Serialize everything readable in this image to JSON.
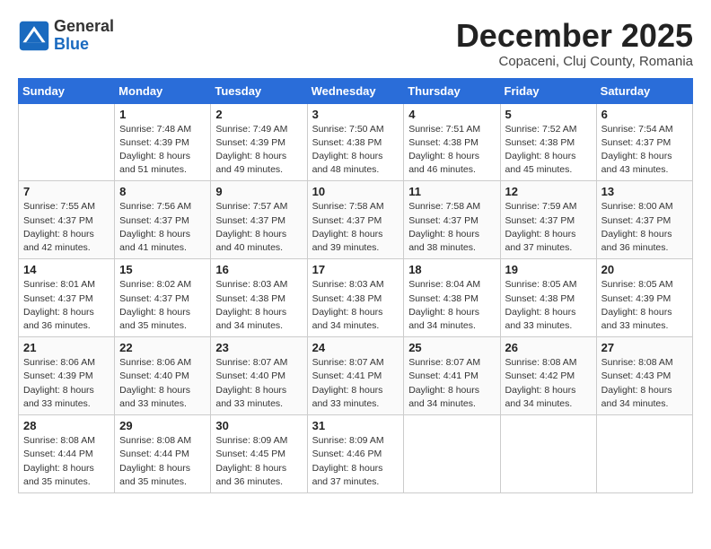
{
  "header": {
    "logo_line1": "General",
    "logo_line2": "Blue",
    "month": "December 2025",
    "location": "Copaceni, Cluj County, Romania"
  },
  "weekdays": [
    "Sunday",
    "Monday",
    "Tuesday",
    "Wednesday",
    "Thursday",
    "Friday",
    "Saturday"
  ],
  "weeks": [
    [
      {
        "day": "",
        "info": ""
      },
      {
        "day": "1",
        "info": "Sunrise: 7:48 AM\nSunset: 4:39 PM\nDaylight: 8 hours\nand 51 minutes."
      },
      {
        "day": "2",
        "info": "Sunrise: 7:49 AM\nSunset: 4:39 PM\nDaylight: 8 hours\nand 49 minutes."
      },
      {
        "day": "3",
        "info": "Sunrise: 7:50 AM\nSunset: 4:38 PM\nDaylight: 8 hours\nand 48 minutes."
      },
      {
        "day": "4",
        "info": "Sunrise: 7:51 AM\nSunset: 4:38 PM\nDaylight: 8 hours\nand 46 minutes."
      },
      {
        "day": "5",
        "info": "Sunrise: 7:52 AM\nSunset: 4:38 PM\nDaylight: 8 hours\nand 45 minutes."
      },
      {
        "day": "6",
        "info": "Sunrise: 7:54 AM\nSunset: 4:37 PM\nDaylight: 8 hours\nand 43 minutes."
      }
    ],
    [
      {
        "day": "7",
        "info": "Sunrise: 7:55 AM\nSunset: 4:37 PM\nDaylight: 8 hours\nand 42 minutes."
      },
      {
        "day": "8",
        "info": "Sunrise: 7:56 AM\nSunset: 4:37 PM\nDaylight: 8 hours\nand 41 minutes."
      },
      {
        "day": "9",
        "info": "Sunrise: 7:57 AM\nSunset: 4:37 PM\nDaylight: 8 hours\nand 40 minutes."
      },
      {
        "day": "10",
        "info": "Sunrise: 7:58 AM\nSunset: 4:37 PM\nDaylight: 8 hours\nand 39 minutes."
      },
      {
        "day": "11",
        "info": "Sunrise: 7:58 AM\nSunset: 4:37 PM\nDaylight: 8 hours\nand 38 minutes."
      },
      {
        "day": "12",
        "info": "Sunrise: 7:59 AM\nSunset: 4:37 PM\nDaylight: 8 hours\nand 37 minutes."
      },
      {
        "day": "13",
        "info": "Sunrise: 8:00 AM\nSunset: 4:37 PM\nDaylight: 8 hours\nand 36 minutes."
      }
    ],
    [
      {
        "day": "14",
        "info": "Sunrise: 8:01 AM\nSunset: 4:37 PM\nDaylight: 8 hours\nand 36 minutes."
      },
      {
        "day": "15",
        "info": "Sunrise: 8:02 AM\nSunset: 4:37 PM\nDaylight: 8 hours\nand 35 minutes."
      },
      {
        "day": "16",
        "info": "Sunrise: 8:03 AM\nSunset: 4:38 PM\nDaylight: 8 hours\nand 34 minutes."
      },
      {
        "day": "17",
        "info": "Sunrise: 8:03 AM\nSunset: 4:38 PM\nDaylight: 8 hours\nand 34 minutes."
      },
      {
        "day": "18",
        "info": "Sunrise: 8:04 AM\nSunset: 4:38 PM\nDaylight: 8 hours\nand 34 minutes."
      },
      {
        "day": "19",
        "info": "Sunrise: 8:05 AM\nSunset: 4:38 PM\nDaylight: 8 hours\nand 33 minutes."
      },
      {
        "day": "20",
        "info": "Sunrise: 8:05 AM\nSunset: 4:39 PM\nDaylight: 8 hours\nand 33 minutes."
      }
    ],
    [
      {
        "day": "21",
        "info": "Sunrise: 8:06 AM\nSunset: 4:39 PM\nDaylight: 8 hours\nand 33 minutes."
      },
      {
        "day": "22",
        "info": "Sunrise: 8:06 AM\nSunset: 4:40 PM\nDaylight: 8 hours\nand 33 minutes."
      },
      {
        "day": "23",
        "info": "Sunrise: 8:07 AM\nSunset: 4:40 PM\nDaylight: 8 hours\nand 33 minutes."
      },
      {
        "day": "24",
        "info": "Sunrise: 8:07 AM\nSunset: 4:41 PM\nDaylight: 8 hours\nand 33 minutes."
      },
      {
        "day": "25",
        "info": "Sunrise: 8:07 AM\nSunset: 4:41 PM\nDaylight: 8 hours\nand 34 minutes."
      },
      {
        "day": "26",
        "info": "Sunrise: 8:08 AM\nSunset: 4:42 PM\nDaylight: 8 hours\nand 34 minutes."
      },
      {
        "day": "27",
        "info": "Sunrise: 8:08 AM\nSunset: 4:43 PM\nDaylight: 8 hours\nand 34 minutes."
      }
    ],
    [
      {
        "day": "28",
        "info": "Sunrise: 8:08 AM\nSunset: 4:44 PM\nDaylight: 8 hours\nand 35 minutes."
      },
      {
        "day": "29",
        "info": "Sunrise: 8:08 AM\nSunset: 4:44 PM\nDaylight: 8 hours\nand 35 minutes."
      },
      {
        "day": "30",
        "info": "Sunrise: 8:09 AM\nSunset: 4:45 PM\nDaylight: 8 hours\nand 36 minutes."
      },
      {
        "day": "31",
        "info": "Sunrise: 8:09 AM\nSunset: 4:46 PM\nDaylight: 8 hours\nand 37 minutes."
      },
      {
        "day": "",
        "info": ""
      },
      {
        "day": "",
        "info": ""
      },
      {
        "day": "",
        "info": ""
      }
    ]
  ]
}
